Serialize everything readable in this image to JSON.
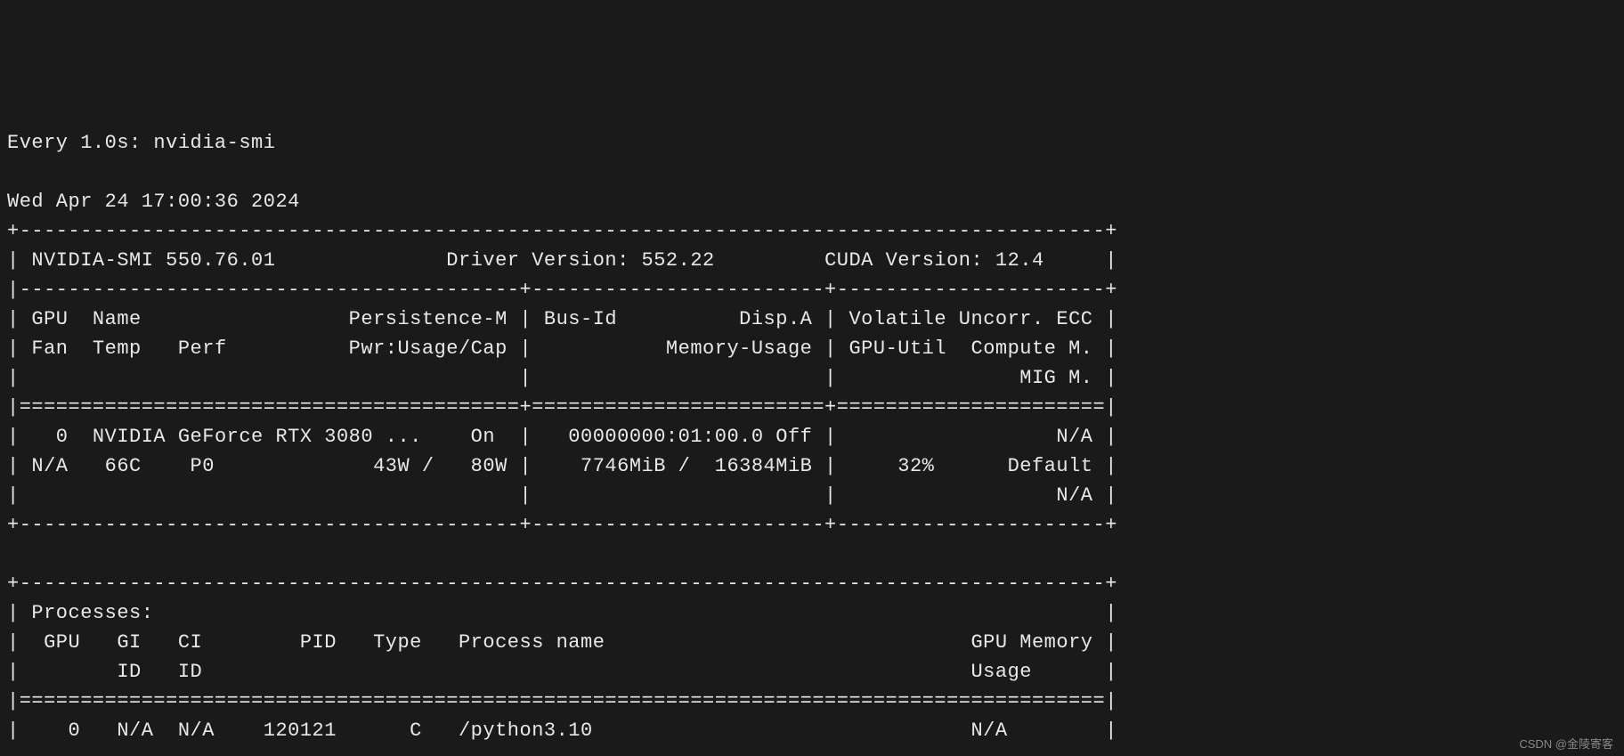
{
  "watch_header": "Every 1.0s: nvidia-smi",
  "timestamp": "Wed Apr 24 17:00:36 2024",
  "smi_version_line": {
    "smi_version": "NVIDIA-SMI 550.76.01",
    "driver_version": "Driver Version: 552.22",
    "cuda_version": "CUDA Version: 12.4"
  },
  "gpu_header": {
    "row1_col1": " GPU  Name                 Persistence-M",
    "row1_col2": " Bus-Id          Disp.A",
    "row1_col3": " Volatile Uncorr. ECC",
    "row2_col1": " Fan  Temp   Perf          Pwr:Usage/Cap",
    "row2_col2": "           Memory-Usage",
    "row2_col3": " GPU-Util  Compute M.",
    "row3_col3": "               MIG M."
  },
  "gpu_data": {
    "row1_col1": "   0  NVIDIA GeForce RTX 3080 ...    On ",
    "row1_col2": "   00000000:01:00.0 Off",
    "row1_col3": "                  N/A",
    "row2_col1": " N/A   66C    P0             43W /   80W",
    "row2_col2": "    7746MiB /  16384MiB",
    "row2_col3": "     32%      Default",
    "row3_col3": "                  N/A"
  },
  "processes": {
    "title": " Processes:",
    "header_row1": "  GPU   GI   CI        PID   Type   Process name                              GPU Memory",
    "header_row2": "        ID   ID                                                               Usage     ",
    "data_row": "    0   N/A  N/A    120121      C   /python3.10                               N/A       "
  },
  "watermark": "CSDN @金陵寄客",
  "chart_data": {
    "type": "table",
    "title": "nvidia-smi output",
    "gpu": {
      "index": 0,
      "name": "NVIDIA GeForce RTX 3080",
      "persistence_m": "On",
      "bus_id": "00000000:01:00.0",
      "disp_a": "Off",
      "ecc": "N/A",
      "fan": "N/A",
      "temp_c": 66,
      "perf": "P0",
      "power_usage_w": 43,
      "power_cap_w": 80,
      "memory_used_mib": 7746,
      "memory_total_mib": 16384,
      "gpu_util_pct": 32,
      "compute_mode": "Default",
      "mig_mode": "N/A"
    },
    "versions": {
      "nvidia_smi": "550.76.01",
      "driver": "552.22",
      "cuda": "12.4"
    },
    "processes": [
      {
        "gpu": 0,
        "gi_id": "N/A",
        "ci_id": "N/A",
        "pid": 120121,
        "type": "C",
        "process_name": "/python3.10",
        "gpu_memory_usage": "N/A"
      }
    ]
  }
}
